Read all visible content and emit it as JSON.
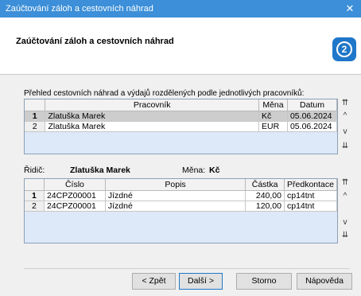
{
  "window": {
    "title": "Zaúčtování záloh a cestovních náhrad",
    "close_glyph": "✕"
  },
  "header": {
    "title": "Zaúčtování záloh a cestovních náhrad",
    "logo_glyph": "2"
  },
  "description": "Přehled cestovních náhrad a výdajů rozdělených podle jednotlivých pracovníků:",
  "workers_table": {
    "columns": {
      "worker": "Pracovník",
      "currency": "Měna",
      "date": "Datum"
    },
    "rows": [
      {
        "num": "1",
        "worker": "Zlatuška Marek",
        "currency": "Kč",
        "date": "05.06.2024"
      },
      {
        "num": "2",
        "worker": "Zlatuška Marek",
        "currency": "EUR",
        "date": "05.06.2024"
      }
    ]
  },
  "driver": {
    "label": "Řidič:",
    "name": "Zlatuška Marek",
    "currency_label": "Měna:",
    "currency": "Kč"
  },
  "items_table": {
    "columns": {
      "number": "Číslo",
      "description": "Popis",
      "amount": "Částka",
      "precontact": "Předkontace"
    },
    "rows": [
      {
        "num": "1",
        "number": "24CPZ00001",
        "description": "Jízdné",
        "amount": "240,00",
        "precontact": "cp14tnt"
      },
      {
        "num": "2",
        "number": "24CPZ00001",
        "description": "Jízdné",
        "amount": "120,00",
        "precontact": "cp14tnt"
      }
    ]
  },
  "nav": {
    "first": "⇈",
    "prev": "^",
    "next": "v",
    "last": "⇊"
  },
  "buttons": {
    "back": "< Zpět",
    "next": "Další >",
    "cancel": "Storno",
    "help": "Nápověda"
  }
}
